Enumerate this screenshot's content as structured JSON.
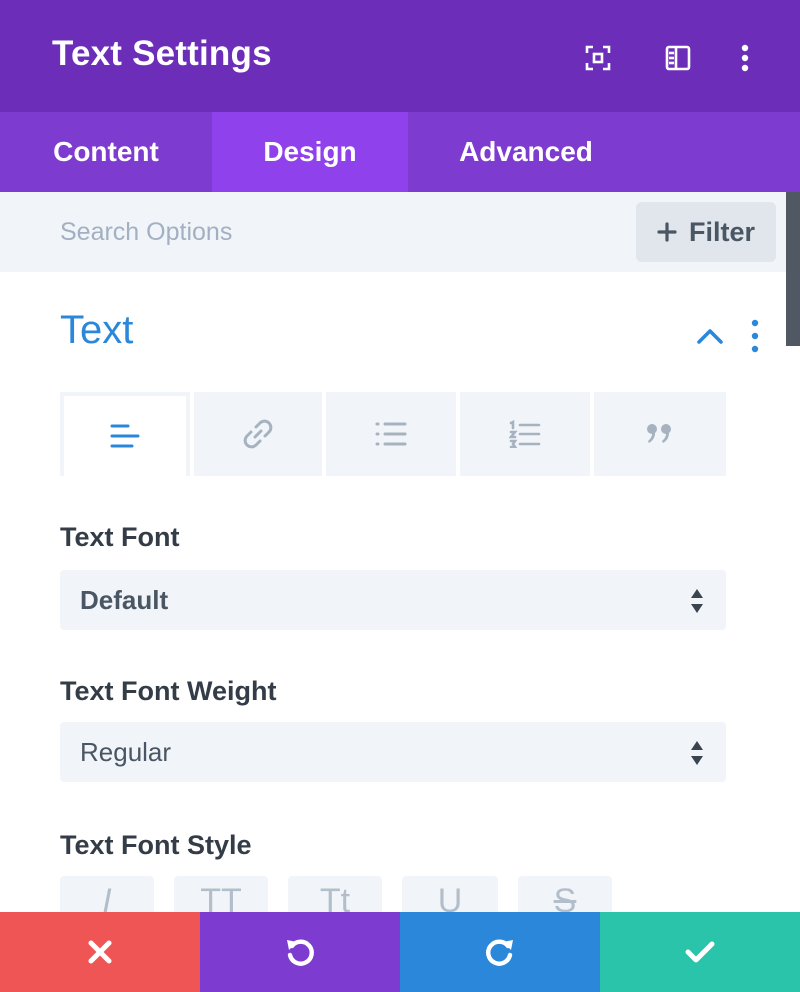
{
  "header": {
    "title": "Text Settings",
    "icons": [
      "fullscreen-icon",
      "sidebar-toggle-icon",
      "more-vertical-icon"
    ]
  },
  "tabs": [
    {
      "label": "Content",
      "active": false
    },
    {
      "label": "Design",
      "active": true
    },
    {
      "label": "Advanced",
      "active": false
    }
  ],
  "search": {
    "placeholder": "Search Options",
    "value": ""
  },
  "filter": {
    "label": "Filter",
    "icon": "plus-icon"
  },
  "section": {
    "title": "Text",
    "expanded": true
  },
  "subtabs": [
    {
      "icon": "align-left-icon",
      "active": true
    },
    {
      "icon": "link-icon",
      "active": false
    },
    {
      "icon": "bulleted-list-icon",
      "active": false
    },
    {
      "icon": "numbered-list-icon",
      "active": false
    },
    {
      "icon": "quote-icon",
      "active": false
    }
  ],
  "fields": {
    "font": {
      "label": "Text Font",
      "value": "Default"
    },
    "weight": {
      "label": "Text Font Weight",
      "value": "Regular"
    },
    "style": {
      "label": "Text Font Style",
      "buttons": [
        "I",
        "TT",
        "Tt",
        "U",
        "S"
      ]
    }
  },
  "footer": {
    "buttons": [
      {
        "name": "discard",
        "icon": "close-icon",
        "color": "#ef5555"
      },
      {
        "name": "undo",
        "icon": "undo-icon",
        "color": "#7e3bd0"
      },
      {
        "name": "redo",
        "icon": "redo-icon",
        "color": "#2b87da"
      },
      {
        "name": "save",
        "icon": "check-icon",
        "color": "#29c4a9"
      }
    ]
  },
  "colors": {
    "header": "#6c2eb9",
    "tabs": "#7e3bd0",
    "active_tab": "#8f42ec",
    "accent": "#2b87da"
  }
}
